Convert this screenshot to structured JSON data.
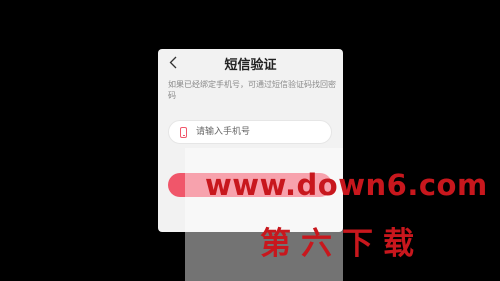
{
  "dialog": {
    "title": "短信验证",
    "back_icon": "chevron-left-icon",
    "hint": "如果已经绑定手机号，可通过短信验证码找回密码",
    "phone_field": {
      "icon": "mobile-phone-icon",
      "value": "",
      "placeholder": "请输入手机号"
    },
    "submit_label": "",
    "accent_color": "#f0566a"
  },
  "watermark": {
    "url": "www.down6.com",
    "name": "第六下载"
  }
}
